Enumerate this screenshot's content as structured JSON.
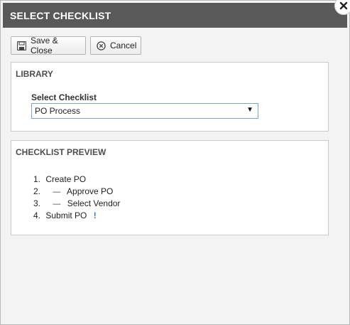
{
  "dialog": {
    "title": "SELECT CHECKLIST",
    "close_icon": "close-icon"
  },
  "toolbar": {
    "save_label": "Save & Close",
    "save_icon": "floppy-disk-icon",
    "cancel_label": "Cancel",
    "cancel_icon": "cancel-circle-icon"
  },
  "library": {
    "heading": "LIBRARY",
    "field_label": "Select Checklist",
    "selected_value": "PO Process"
  },
  "preview": {
    "heading": "CHECKLIST PREVIEW",
    "steps": [
      {
        "number": "1.",
        "text": "Create PO",
        "sub": false,
        "flag": ""
      },
      {
        "number": "2.",
        "text": "Approve PO",
        "sub": true,
        "flag": ""
      },
      {
        "number": "3.",
        "text": "Select Vendor",
        "sub": true,
        "flag": ""
      },
      {
        "number": "4.",
        "text": "Submit PO",
        "sub": false,
        "flag": "!"
      }
    ]
  },
  "colors": {
    "titlebar": "#595959",
    "select_border": "#7aa7d6",
    "warning": "#2a7de1"
  }
}
